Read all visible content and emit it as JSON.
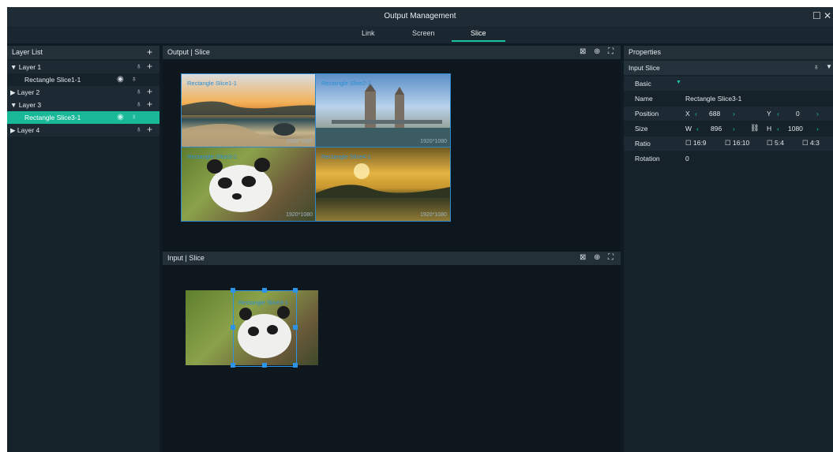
{
  "window": {
    "title": "Output Management",
    "maximize_glyph": "☐",
    "close_glyph": "✕"
  },
  "tabs": [
    {
      "label": "Link"
    },
    {
      "label": "Screen"
    },
    {
      "label": "Slice"
    }
  ],
  "layer_list": {
    "title": "Layer List",
    "add_glyph": "+",
    "items": [
      {
        "label": "▼ Layer 1"
      },
      {
        "label": "Rectangle Slice1-1"
      },
      {
        "label": "▶ Layer 2"
      },
      {
        "label": "▼ Layer 3"
      },
      {
        "label": "Rectangle Slice3-1"
      },
      {
        "label": "▶ Layer 4"
      }
    ]
  },
  "output_panel": {
    "title": "Output | Slice",
    "tiles": [
      {
        "caption": "Rectangle Slice1-1",
        "resolution": "1920*1080"
      },
      {
        "caption": "Rectangle Slice2-1",
        "resolution": "1920*1080"
      },
      {
        "caption": "Rectangle Slice3-1",
        "resolution": "1920*1080"
      },
      {
        "caption": "Rectangle Slice4-1",
        "resolution": "1920*1080"
      }
    ]
  },
  "input_panel": {
    "title": "Input | Slice",
    "slice_caption": "Rectangle Slice3-1"
  },
  "properties": {
    "title": "Properties",
    "section": "Input Slice",
    "basic_label": "Basic",
    "name_label": "Name",
    "name_value": "Rectangle Slice3-1",
    "position_label": "Position",
    "x_label": "X",
    "x_value": "688",
    "y_label": "Y",
    "y_value": "0",
    "size_label": "Size",
    "w_label": "W",
    "w_value": "896",
    "h_label": "H",
    "h_value": "1080",
    "ratio_label": "Ratio",
    "ratio_options": [
      "16:9",
      "16:10",
      "5:4",
      "4:3"
    ],
    "rotation_label": "Rotation",
    "rotation_value": "0"
  },
  "colors": {
    "accent": "#19c3a2",
    "selection": "#19b899",
    "handle": "#2d93e6",
    "caption": "#2c8fd6"
  }
}
